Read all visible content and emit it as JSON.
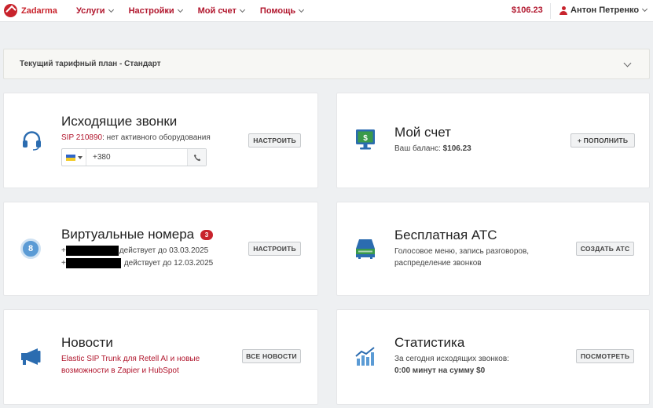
{
  "header": {
    "logo_text": "Zadarma",
    "nav": [
      {
        "label": "Услуги"
      },
      {
        "label": "Настройки"
      },
      {
        "label": "Мой счет"
      },
      {
        "label": "Помощь"
      }
    ],
    "balance": "$106.23",
    "user_name": "Антон Петренко"
  },
  "tariff": {
    "text": "Текущий тарифный план - Стандарт"
  },
  "cards": {
    "outgoing": {
      "title": "Исходящие звонки",
      "sip_label": "SIP 210890",
      "sip_status": ": нет активного оборудования",
      "phone_value": "+380",
      "button": "НАСТРОИТЬ"
    },
    "account": {
      "title": "Мой счет",
      "balance_label": "Ваш баланс:",
      "balance_value": "$106.23",
      "button": "+ ПОПОЛНИТЬ"
    },
    "numbers": {
      "title": "Виртуальные номера",
      "badge": "3",
      "icon_label": "8",
      "rows": [
        {
          "prefix": "+",
          "text": "действует до 03.03.2025"
        },
        {
          "prefix": "+",
          "text": "действует до 12.03.2025"
        }
      ],
      "button": "НАСТРОИТЬ"
    },
    "pbx": {
      "title": "Бесплатная АТС",
      "line1": "Голосовое меню, запись разговоров,",
      "line2": "распределение звонков",
      "button": "СОЗДАТЬ АТС"
    },
    "news": {
      "title": "Новости",
      "line1": "Elastic SIP Trunk для Retell AI и новые",
      "line2": "возможности в Zapier и HubSpot",
      "button": "ВСЕ НОВОСТИ"
    },
    "stats": {
      "title": "Статистика",
      "line1": "За сегодня исходящих звонков:",
      "line2": "0:00 минут на сумму $0",
      "button": "ПОСМОТРЕТЬ"
    }
  },
  "colors": {
    "brand": "#c8232c",
    "nav_text": "#b1162d",
    "icon_blue": "#2b6cb0",
    "icon_green": "#3a9a4a"
  },
  "icons": [
    "zadarma-logo-icon",
    "headset-icon",
    "monitor-dollar-icon",
    "number-circle-icon",
    "pbx-device-icon",
    "megaphone-icon",
    "bar-chart-icon",
    "phone-icon",
    "user-icon"
  ]
}
